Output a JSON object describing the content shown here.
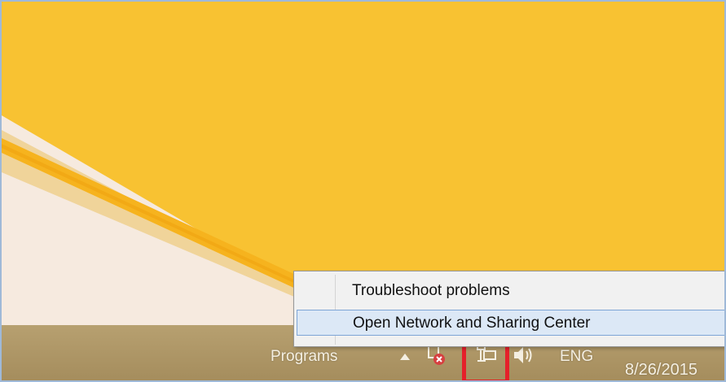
{
  "context_menu": {
    "items": [
      {
        "label": "Troubleshoot problems"
      },
      {
        "label": "Open Network and Sharing Center",
        "hovered": true
      }
    ]
  },
  "taskbar": {
    "programs_label": "Programs",
    "language": "ENG",
    "date": "8/26/2015",
    "tray_icons": [
      "show-hidden-icons-arrow",
      "action-center-error-icon",
      "network-wired-icon",
      "volume-icon"
    ]
  },
  "colors": {
    "wallpaper_yellow": "#f8c232",
    "taskbar": "#ab935f",
    "menu_hover": "#dce8f6",
    "highlight_red": "#e5202a"
  }
}
